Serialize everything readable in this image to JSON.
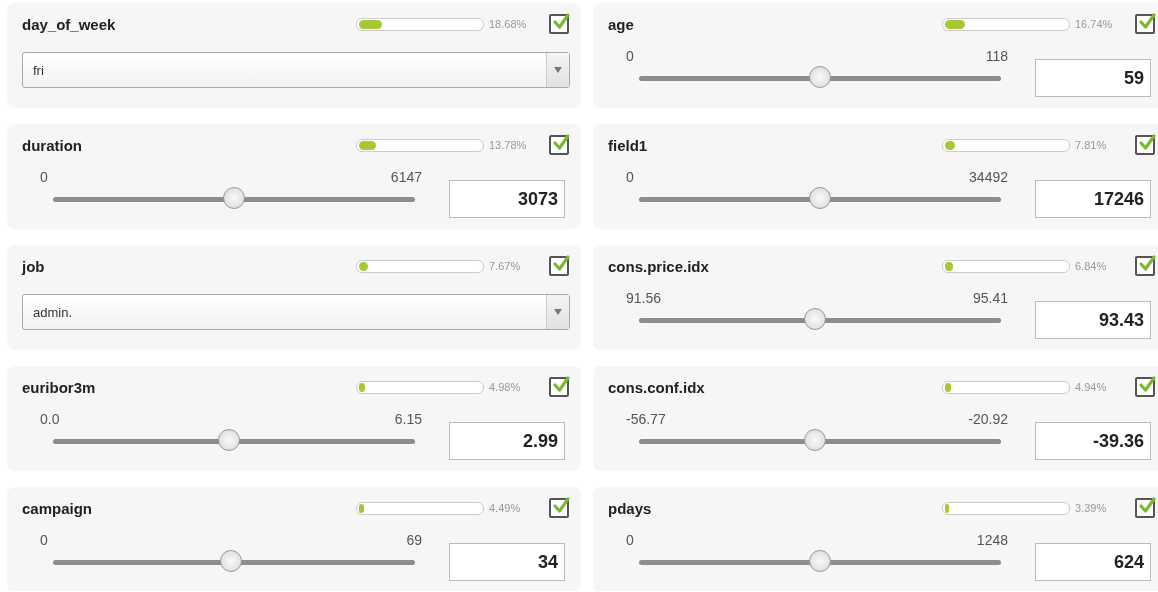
{
  "features": [
    {
      "kind": "dropdown",
      "name": "day_of_week",
      "importance": {
        "level": 0.1868,
        "reading": "18.68%"
      },
      "checked": true,
      "value": "fri"
    },
    {
      "kind": "slider",
      "name": "age",
      "importance": {
        "level": 0.1674,
        "reading": "16.74%"
      },
      "checked": true,
      "min": "0",
      "max": "118",
      "value": "59",
      "level": 0.5
    },
    {
      "kind": "slider",
      "name": "duration",
      "importance": {
        "level": 0.1378,
        "reading": "13.78%"
      },
      "checked": true,
      "min": "0",
      "max": "6147",
      "value": "3073",
      "level": 0.5
    },
    {
      "kind": "slider",
      "name": "field1",
      "importance": {
        "level": 0.0781,
        "reading": "7.81%"
      },
      "checked": true,
      "min": "0",
      "max": "34492",
      "value": "17246",
      "level": 0.5
    },
    {
      "kind": "dropdown",
      "name": "job",
      "importance": {
        "level": 0.0767,
        "reading": "7.67%"
      },
      "checked": true,
      "value": "admin."
    },
    {
      "kind": "slider",
      "name": "cons.price.idx",
      "importance": {
        "level": 0.0684,
        "reading": "6.84%"
      },
      "checked": true,
      "min": "91.56",
      "max": "95.41",
      "value": "93.43",
      "level": 0.486
    },
    {
      "kind": "slider",
      "name": "euribor3m",
      "importance": {
        "level": 0.0498,
        "reading": "4.98%"
      },
      "checked": true,
      "min": "0.0",
      "max": "6.15",
      "value": "2.99",
      "level": 0.486
    },
    {
      "kind": "slider",
      "name": "cons.conf.idx",
      "importance": {
        "level": 0.0494,
        "reading": "4.94%"
      },
      "checked": true,
      "min": "-56.77",
      "max": "-20.92",
      "value": "-39.36",
      "level": 0.486
    },
    {
      "kind": "slider",
      "name": "campaign",
      "importance": {
        "level": 0.0449,
        "reading": "4.49%"
      },
      "checked": true,
      "min": "0",
      "max": "69",
      "value": "34",
      "level": 0.493
    },
    {
      "kind": "slider",
      "name": "pdays",
      "importance": {
        "level": 0.0339,
        "reading": "3.39%"
      },
      "checked": true,
      "min": "0",
      "max": "1248",
      "value": "624",
      "level": 0.5
    }
  ]
}
